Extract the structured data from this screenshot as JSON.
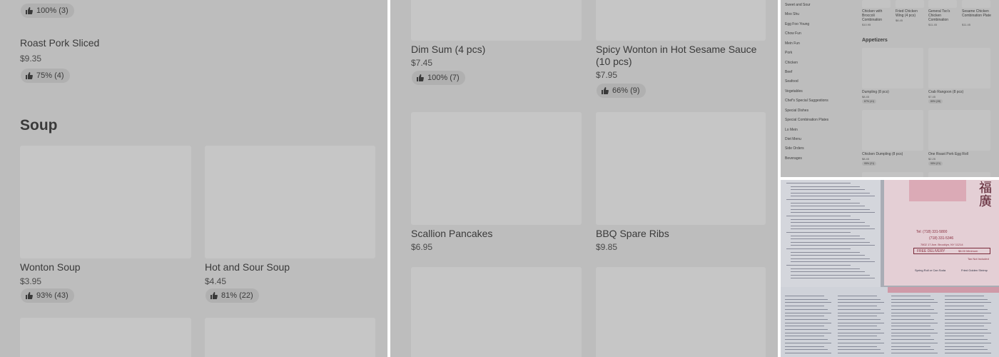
{
  "panel_a": {
    "top_rating": "100% (3)",
    "items": [
      {
        "name": "Roast Pork Sliced",
        "price": "$9.35",
        "rating": "75% (4)"
      }
    ],
    "section_title": "Soup",
    "soup_items": [
      {
        "name": "Wonton Soup",
        "price": "$3.95",
        "rating": "93% (43)"
      },
      {
        "name": "Hot and Sour Soup",
        "price": "$4.45",
        "rating": "81% (22)"
      }
    ]
  },
  "panel_b": {
    "items": [
      {
        "name": "Dim Sum (4 pcs)",
        "price": "$7.45",
        "rating": "100% (7)"
      },
      {
        "name": "Spicy Wonton in Hot Sesame Sauce (10 pcs)",
        "price": "$7.95",
        "rating": "66% (9)"
      },
      {
        "name": "Scallion Pancakes",
        "price": "$6.95"
      },
      {
        "name": "BBQ Spare Ribs",
        "price": "$9.85"
      }
    ]
  },
  "panel_c": {
    "categories": [
      "Sweet and Sour",
      "Moo Shu",
      "Egg Foo Young",
      "Chow Fun",
      "Mein Fun",
      "Pork",
      "Chicken",
      "Beef",
      "Seafood",
      "Vegetables",
      "Chef's Special Suggestions",
      "Special Dishes",
      "Special Combination Plates",
      "Lo Mein",
      "Diet Menu",
      "Side Orders",
      "Beverages"
    ],
    "top_items": [
      {
        "name": "Chicken with Broccoli Combination",
        "price": "$10.95"
      },
      {
        "name": "Fried Chicken Wing (4 pcs)",
        "price": "$8.45"
      },
      {
        "name": "General Tso's Chicken Combination",
        "price": "$11.45"
      },
      {
        "name": "Sesame Chicken Combination Plate",
        "price": "$11.45"
      }
    ],
    "section_title": "Appetizers",
    "appetizers": [
      {
        "name": "Dumpling (8 pcs)",
        "price": "$8.45",
        "rating": "87% (41)"
      },
      {
        "name": "Crab Rangoon (8 pcs)",
        "price": "$7.45",
        "rating": "89% (28)"
      },
      {
        "name": "Chicken Dumpling (8 pcs)",
        "price": "$8.45",
        "rating": "95% (21)"
      },
      {
        "name": "One Roast Pork Egg Roll",
        "price": "$2.25",
        "rating": "95% (21)"
      }
    ]
  },
  "panel_d": {
    "phone_1": "Tel: (718) 331-5800",
    "phone_2": "(718) 331-5346",
    "address": "7802 17 Ave. Brooklyn, NY 11214",
    "banner": "FREE DELIVERY",
    "minimum": "$8.00 Minimum",
    "note": "Tax Not Included",
    "promo_1": "Spring Roll or Can Soda",
    "promo_2": "Fried Golden Shrimp"
  },
  "colors": {
    "overlay_gray": "#bdbdbd",
    "placeholder": "#c6c6c6",
    "pill": "#b0b0b0",
    "menu_red": "#8a3040"
  },
  "icons": {
    "rating": "thumbs-up-icon"
  }
}
